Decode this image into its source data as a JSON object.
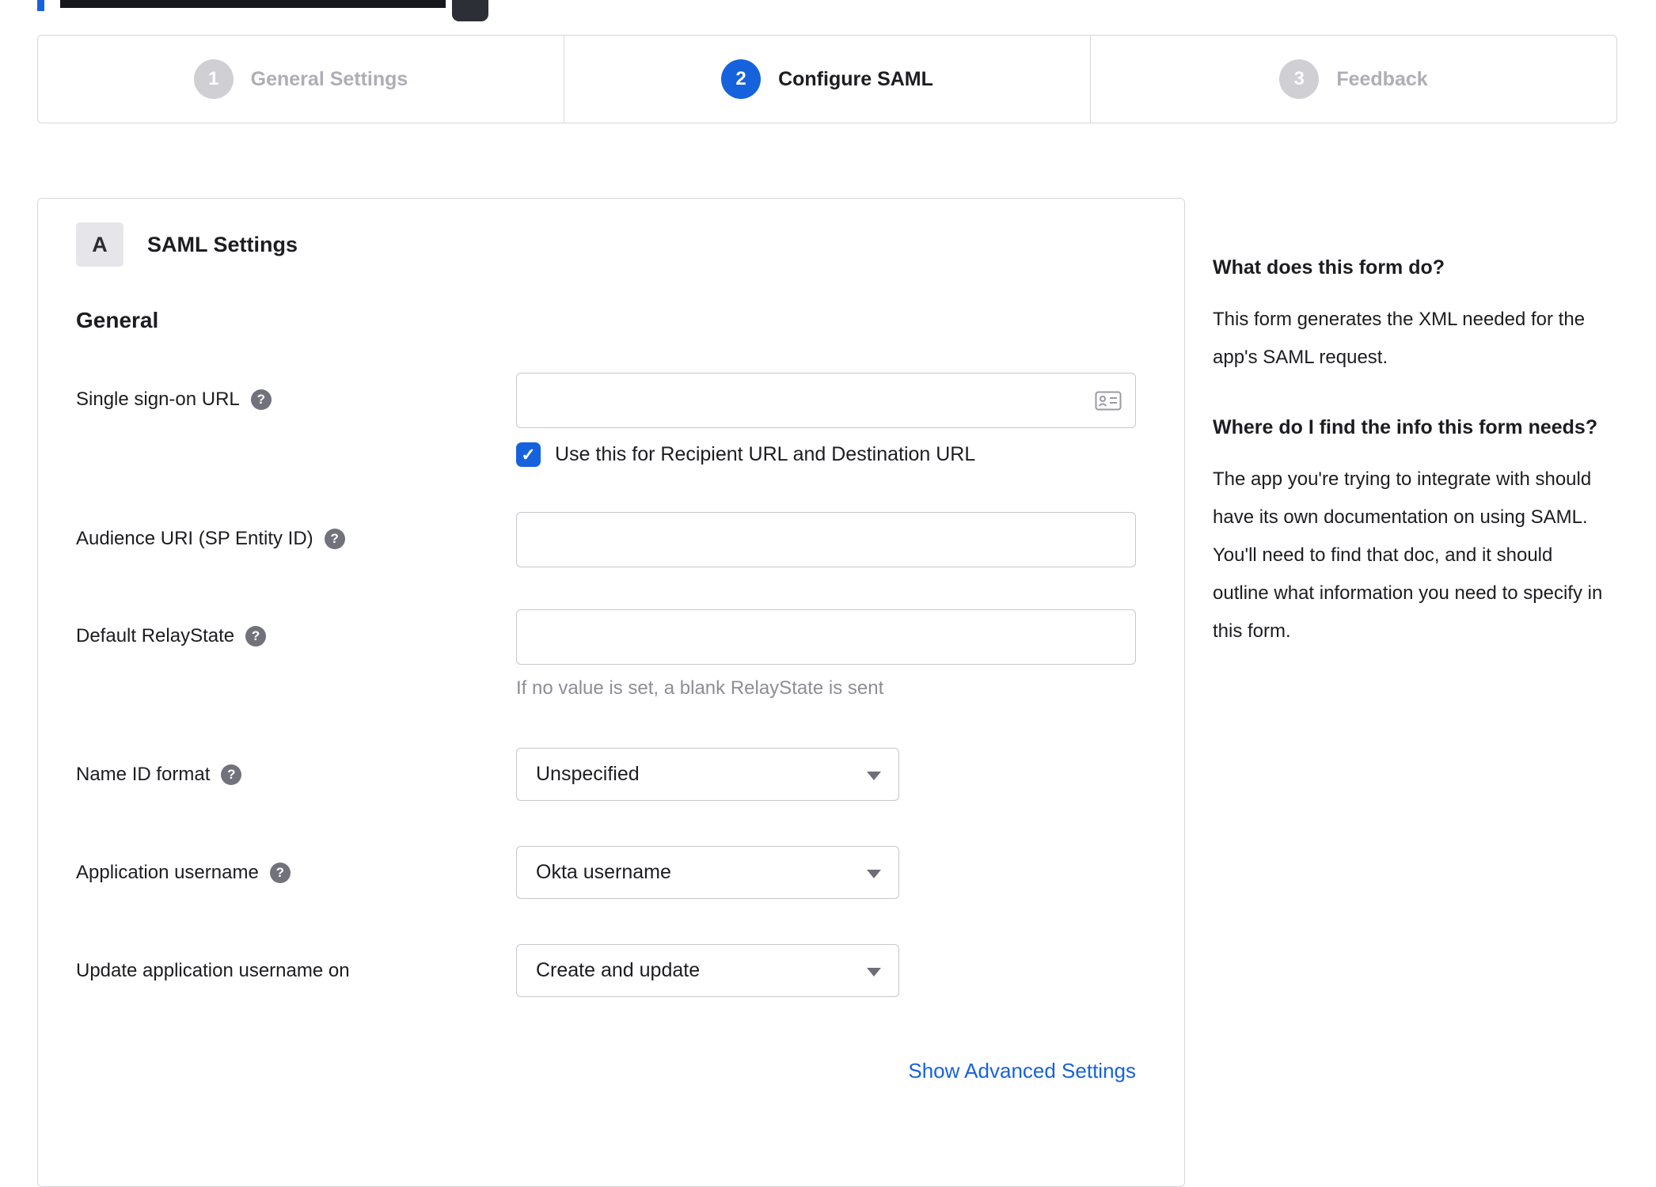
{
  "header_artifacts": {
    "note": "cropped page-title remnants"
  },
  "stepper": {
    "steps": [
      {
        "number": "1",
        "label": "General Settings",
        "state": "inactive"
      },
      {
        "number": "2",
        "label": "Configure SAML",
        "state": "active"
      },
      {
        "number": "3",
        "label": "Feedback",
        "state": "inactive"
      }
    ]
  },
  "panel": {
    "badge": "A",
    "title": "SAML Settings",
    "section_title": "General",
    "fields": {
      "sso": {
        "label": "Single sign-on URL",
        "value": "",
        "checkbox_label": "Use this for Recipient URL and Destination URL",
        "checked": true,
        "check_glyph": "✓"
      },
      "audience": {
        "label": "Audience URI (SP Entity ID)",
        "value": ""
      },
      "relay": {
        "label": "Default RelayState",
        "value": "",
        "help": "If no value is set, a blank RelayState is sent"
      },
      "nameid": {
        "label": "Name ID format",
        "value": "Unspecified"
      },
      "appuser": {
        "label": "Application username",
        "value": "Okta username"
      },
      "update": {
        "label": "Update application username on",
        "value": "Create and update"
      }
    },
    "help_glyph": "?",
    "advanced_link": "Show Advanced Settings"
  },
  "sidebar": {
    "q1": "What does this form do?",
    "a1": "This form generates the XML needed for the app's SAML request.",
    "q2": "Where do I find the info this form needs?",
    "a2": "The app you're trying to integrate with should have its own documentation on using SAML. You'll need to find that doc, and it should outline what information you need to specify in this form."
  },
  "colors": {
    "accent": "#1662dd",
    "border": "#d7d7dc",
    "muted": "#8d8d95"
  }
}
